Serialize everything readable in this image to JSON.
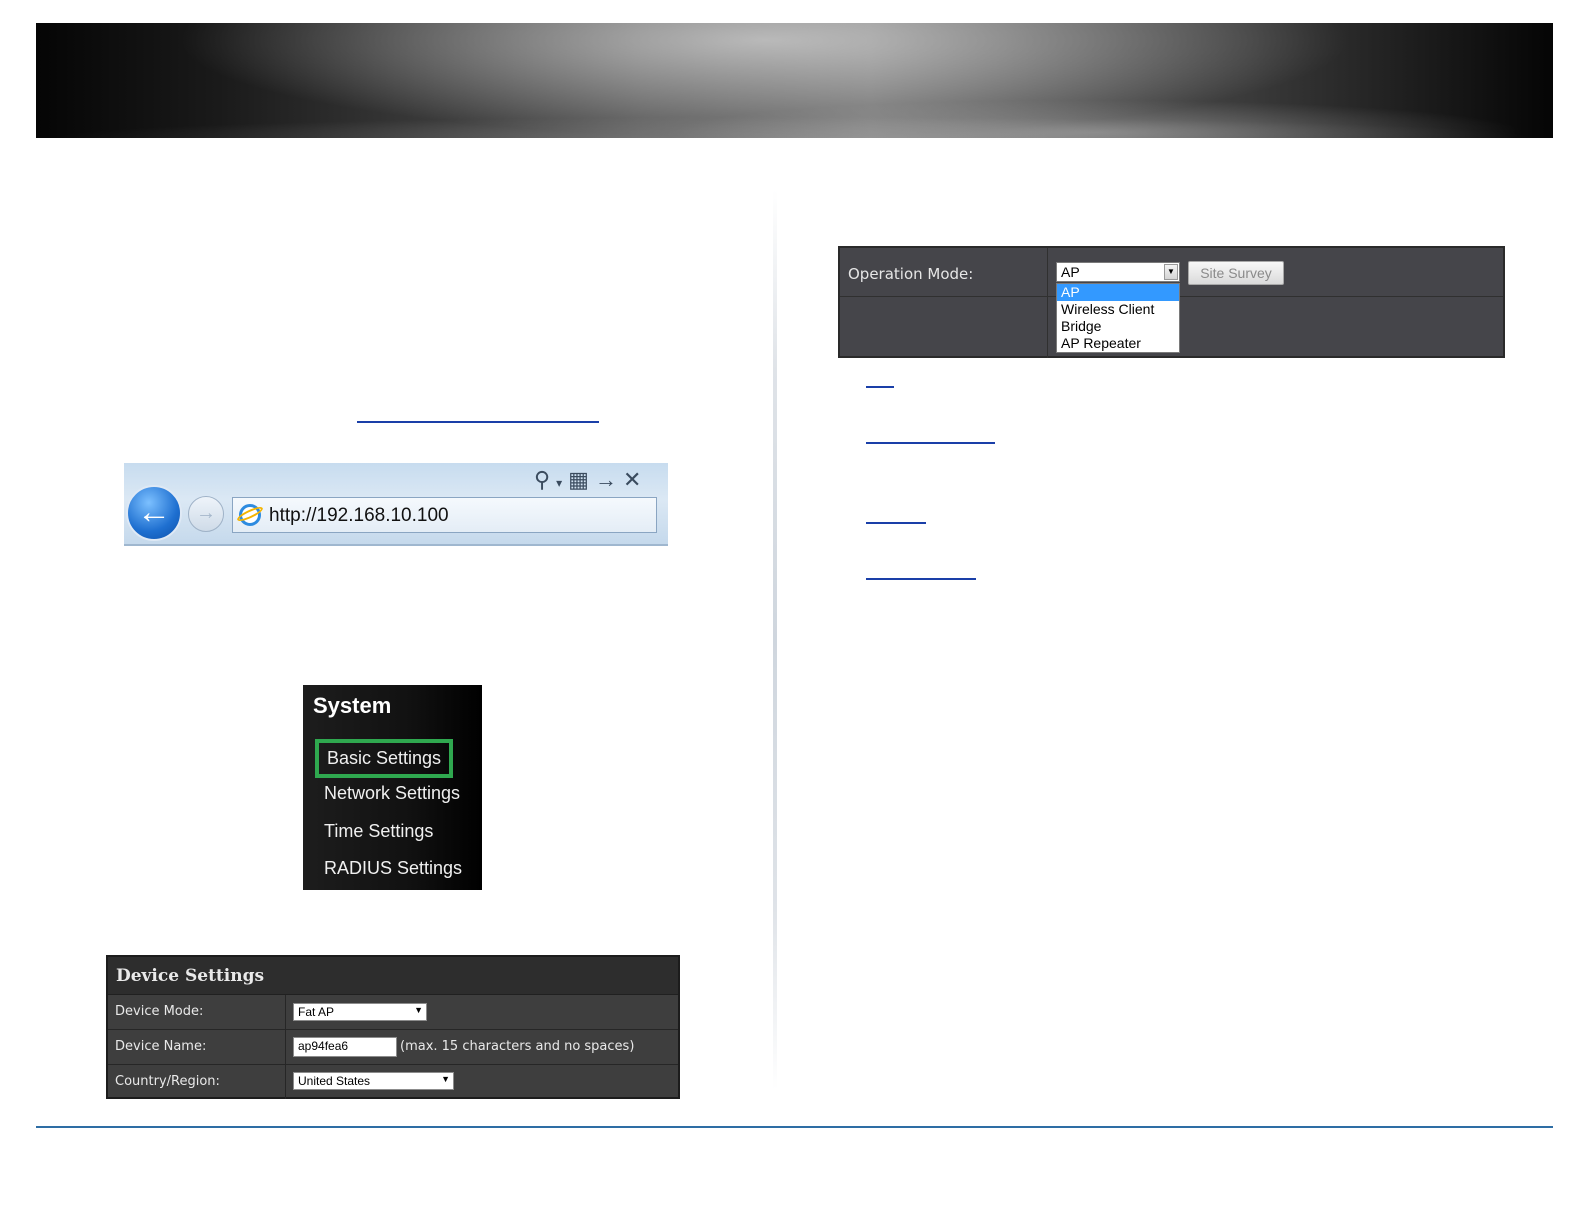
{
  "browser": {
    "url": "http://192.168.10.100"
  },
  "system_menu": {
    "title": "System",
    "items": [
      {
        "label": "Basic Settings",
        "active": true
      },
      {
        "label": "Network Settings",
        "active": false
      },
      {
        "label": "Time Settings",
        "active": false
      },
      {
        "label": "RADIUS Settings",
        "active": false
      }
    ],
    "highlight_color": "#2fa84f"
  },
  "device_settings": {
    "title": "Device Settings",
    "device_mode_label": "Device Mode:",
    "device_mode_value": "Fat AP",
    "device_name_label": "Device Name:",
    "device_name_value": "ap94fea6",
    "device_name_hint": "(max. 15 characters and no spaces)",
    "country_label": "Country/Region:",
    "country_value": "United States"
  },
  "operation_mode": {
    "label": "Operation Mode:",
    "selected": "AP",
    "site_survey_label": "Site Survey",
    "options": [
      "AP",
      "Wireless Client",
      "Bridge",
      "AP Repeater"
    ]
  },
  "colors": {
    "link": "#1a3fa8",
    "footer_rule": "#2e6da4"
  }
}
